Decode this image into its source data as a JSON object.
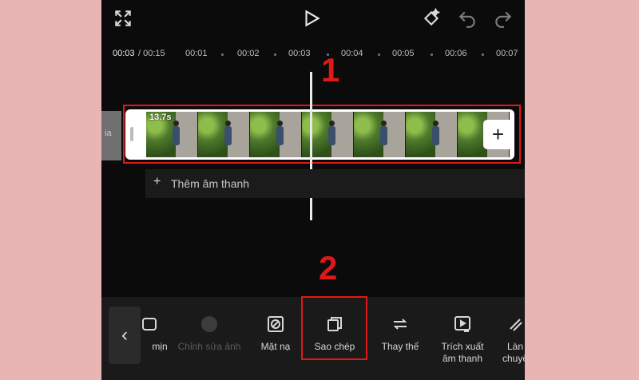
{
  "timeline": {
    "current_time": "00:03",
    "total_time": "/ 00:15",
    "ticks": [
      "00:01",
      "00:02",
      "00:03",
      "00:04",
      "00:05",
      "00:06",
      "00:07"
    ]
  },
  "clip": {
    "duration": "13.7s",
    "add_label": "+"
  },
  "prev_clip_text": "ia",
  "add_audio": {
    "icon": "+",
    "label": "Thêm âm thanh"
  },
  "steps": {
    "one": "1",
    "two": "2"
  },
  "toolbar": {
    "back": "‹",
    "items": [
      {
        "name": "tool-lam-min",
        "label": "mịn",
        "icon": "blur-icon"
      },
      {
        "name": "tool-chinh-sua-anh",
        "label": "Chỉnh sửa ảnh",
        "icon": "edit-photo-icon"
      },
      {
        "name": "tool-mat-na",
        "label": "Mặt nạ",
        "icon": "mask-icon"
      },
      {
        "name": "tool-sao-chep",
        "label": "Sao chép",
        "icon": "copy-icon"
      },
      {
        "name": "tool-thay-the",
        "label": "Thay thế",
        "icon": "replace-icon"
      },
      {
        "name": "tool-trich-xuat",
        "label": "Trích xuất\nâm thanh",
        "icon": "extract-audio-icon"
      },
      {
        "name": "tool-lam-chuyen",
        "label": "Làn\nchuyể",
        "icon": "transition-icon"
      }
    ]
  },
  "colors": {
    "highlight": "#e01818",
    "background": "#e8b4b4"
  }
}
